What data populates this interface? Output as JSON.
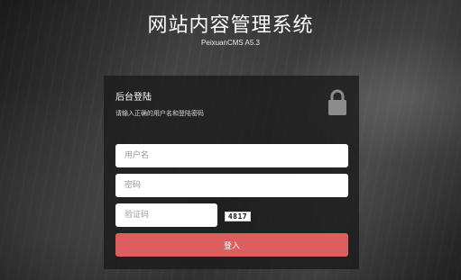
{
  "header": {
    "title": "网站内容管理系统",
    "subtitle": "PeixuanCMS A5.3"
  },
  "panel": {
    "title": "后台登陆",
    "subtitle": "请输入正确的用户名和登陆密码",
    "icon": "lock-icon"
  },
  "form": {
    "username": {
      "value": "",
      "placeholder": "用户名"
    },
    "password": {
      "value": "",
      "placeholder": "密码"
    },
    "captcha": {
      "value": "",
      "placeholder": "验证码"
    },
    "captcha_image_text": "4817",
    "submit_label": "登入"
  },
  "colors": {
    "accent": "#dd5e5e",
    "panel_bg": "#1f1f1f",
    "lock_icon": "#8c8c8c"
  }
}
